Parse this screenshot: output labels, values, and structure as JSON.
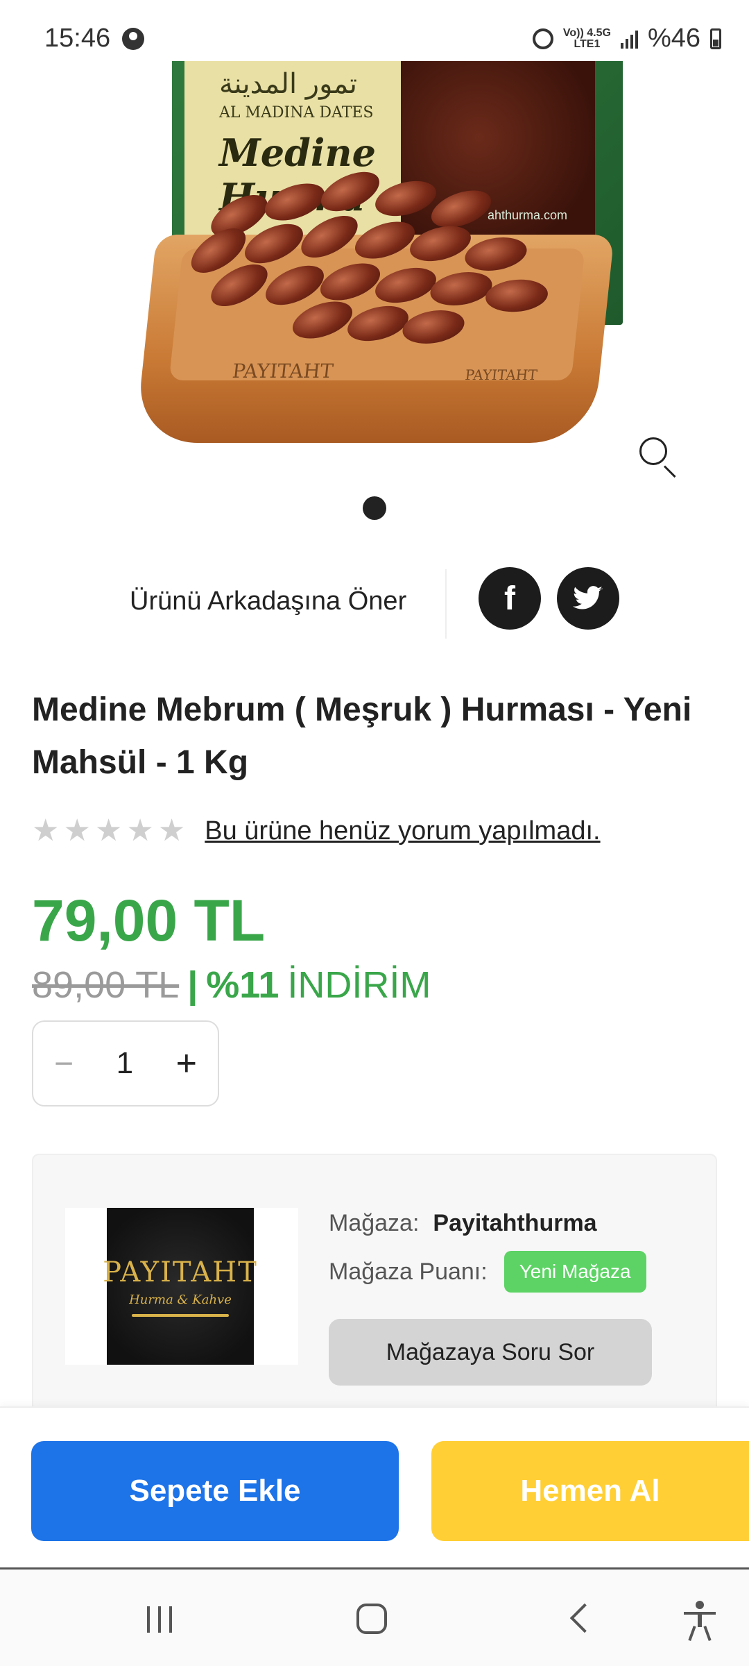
{
  "status_bar": {
    "time": "15:46",
    "network_top": "Vo)) 4.5G",
    "network_bottom": "LTE1",
    "battery": "%46"
  },
  "product_image": {
    "box_arabic": "تمور المدينة",
    "box_english": "AL MADINA DATES",
    "box_brand": "Medine Hurma",
    "box_web": "ahthurma.com",
    "tray_brand": "PAYITAHT",
    "tray_brand2": "PAYITAHT",
    "zoom_icon": "zoom-icon",
    "current_slide": 1,
    "total_slides": 1
  },
  "share": {
    "label": "Ürünü Arkadaşına Öner",
    "facebook_icon": "f",
    "twitter_icon": "t"
  },
  "product": {
    "title": "Medine Mebrum ( Meşruk ) Hurması - Yeni Mahsül - 1 Kg",
    "rating_stars": 0,
    "review_text": "Bu ürüne henüz yorum yapılmadı.",
    "price": "79,00 TL",
    "old_price": "89,00 TL",
    "separator": "|",
    "discount_percent": "%11",
    "discount_word": "İNDİRİM"
  },
  "quantity": {
    "minus": "−",
    "value": "1",
    "plus": "+"
  },
  "store": {
    "logo_text": "PAYITAHT",
    "logo_subtext": "Hurma & Kahve",
    "store_label": "Mağaza:",
    "store_name": "Payitahthurma",
    "rating_label": "Mağaza Puanı:",
    "rating_badge": "Yeni Mağaza",
    "ask_button": "Mağazaya Soru Sor"
  },
  "actions": {
    "add_to_cart": "Sepete Ekle",
    "buy_now": "Hemen Al"
  },
  "colors": {
    "price_green": "#3aa64a",
    "add_cart_blue": "#1d73e8",
    "buy_now_yellow": "#ffcf35",
    "badge_green": "#5cd364"
  }
}
